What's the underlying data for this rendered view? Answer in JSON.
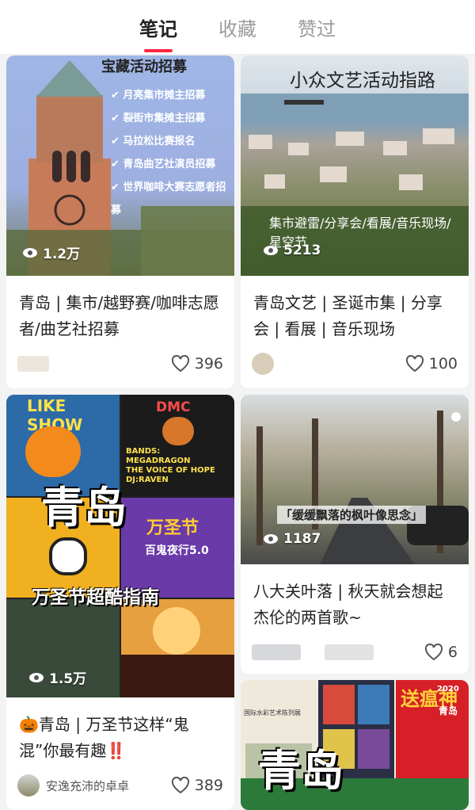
{
  "tabs": [
    {
      "label": "笔记",
      "active": true
    },
    {
      "label": "收藏",
      "active": false
    },
    {
      "label": "赞过",
      "active": false
    }
  ],
  "cards": [
    {
      "id": "c1",
      "cover_title": "宝藏活动招募",
      "cover_items": [
        "月亮集市摊主招募",
        "裂街市集摊主招募",
        "马拉松比赛报名",
        "青岛曲艺社演员招募",
        "世界咖啡大赛志愿者招募"
      ],
      "views": "1.2万",
      "title": "青岛 | 集市/越野赛/咖啡志愿者/曲艺社招募",
      "likes": "396"
    },
    {
      "id": "c2",
      "cover_title": "小众文艺活动指路",
      "cover_sub": "集市避雷/分享会/看展/音乐现场/星空节",
      "views": "5213",
      "title": "青岛文艺 | 圣诞市集 | 分享会 | 看展 | 音乐现场",
      "likes": "100"
    },
    {
      "id": "c3",
      "cover_big": "青岛",
      "cover_sub": "万圣节超酷指南",
      "poster_texts": {
        "like_show": "LIKE SHOW",
        "dmc": "DMC",
        "bands": "BANDS:",
        "mega": "MEGADRAGON",
        "voice": "THE VOICE OF HOPE",
        "dj": "DJ:RAVEN",
        "halloween": "万圣节",
        "night": "百鬼夜行5.0"
      },
      "views": "1.5万",
      "title": "🎃青岛 | 万圣节这样“鬼混”你最有趣‼️",
      "author": "安逸充沛的卓卓",
      "likes": "389"
    },
    {
      "id": "c4",
      "cover_caption": "「缓缓飘落的枫叶像思念」",
      "views": "1187",
      "title": "八大关叶落 | 秋天就会想起杰伦的两首歌~",
      "likes": "6"
    },
    {
      "id": "c5",
      "cover_big": "青岛",
      "poster_texts": {
        "top": "国际水彩艺术陈列展",
        "red": "送瘟神",
        "qd": "青岛",
        "year": "2020"
      }
    }
  ],
  "colors": {
    "accent": "#ff2741",
    "tab_inactive": "#9b9b9b"
  }
}
